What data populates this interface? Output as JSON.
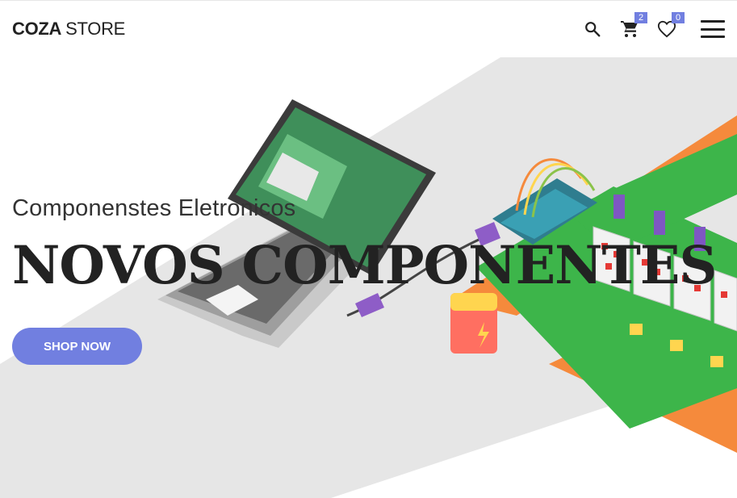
{
  "header": {
    "logo_bold": "COZA",
    "logo_rest": "STORE",
    "cart_count": "2",
    "wishlist_count": "0",
    "icons": [
      "search-icon",
      "cart-icon",
      "heart-icon",
      "menu-icon"
    ]
  },
  "hero": {
    "subtitle": "Componenstes Eletronicos",
    "title": "NOVOS COMPONENTES",
    "button_label": "SHOP NOW"
  },
  "colors": {
    "accent": "#717fe0",
    "text_dark": "#222222",
    "hero_bg": "#e6e6e6",
    "orange": "#f58a3c",
    "green": "#3db54a"
  }
}
